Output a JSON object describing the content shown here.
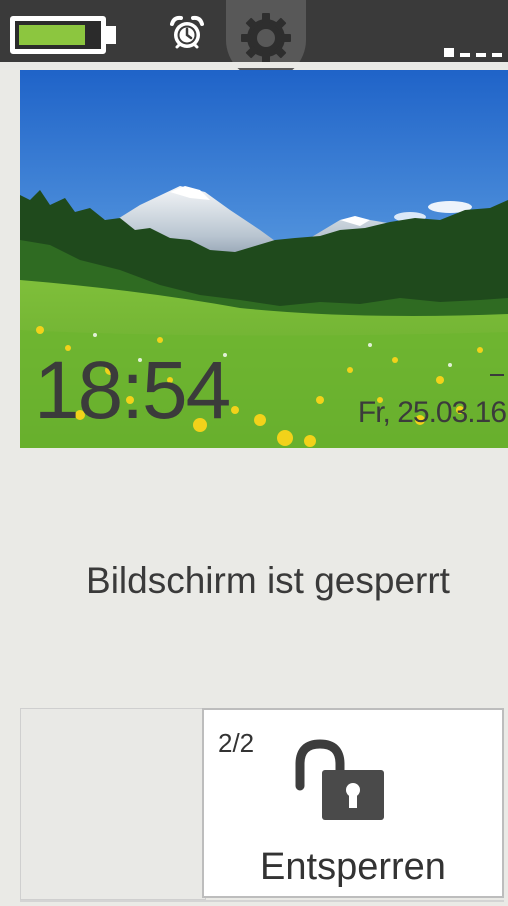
{
  "status_bar": {
    "battery_level": 0.85,
    "battery_color": "#8cc63f",
    "alarm_icon": "alarm-clock-icon",
    "settings_icon": "gear-icon",
    "signal_icon": "signal-dashes-icon"
  },
  "clock_widget": {
    "time": "18:54",
    "date": "Fr, 25.03.16",
    "background": "alpine-meadow-photo"
  },
  "message": "Bildschirm ist gesperrt",
  "unlock": {
    "counter": "2/2",
    "icon": "padlock-open-icon",
    "label": "Entsperren"
  }
}
